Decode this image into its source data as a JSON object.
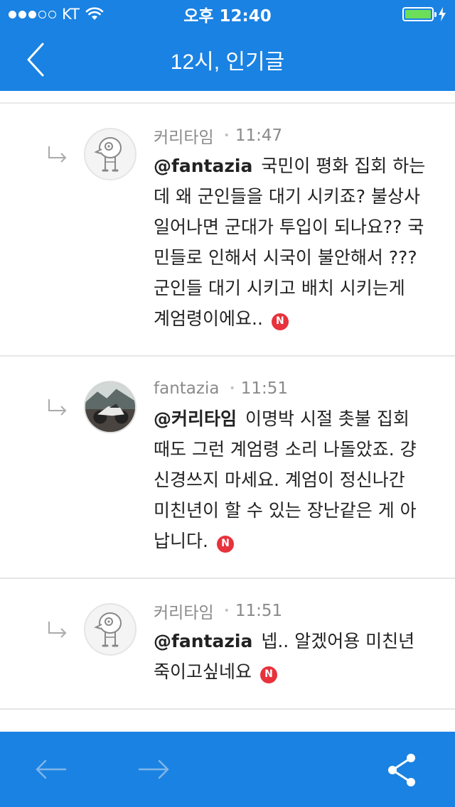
{
  "status_bar": {
    "carrier": "KT",
    "time": "오후 12:40"
  },
  "nav": {
    "title": "12시, 인기글",
    "back_icon": "chevron-left-icon"
  },
  "comments": [
    {
      "author": "커리타임",
      "time": "11:47",
      "mention": "@fantazia",
      "text": "국민이 평화 집회 하는데 왜 군인들을 대기 시키죠? 불상사 일어나면 군대가 투입이 되나요?? 국민들로 인해서 시국이 불안해서 ???군인들 대기 시키고 배치 시키는게 계엄령이에요..",
      "badge": "N",
      "avatar": "character-avatar"
    },
    {
      "author": "fantazia",
      "time": "11:51",
      "mention": "@커리타임",
      "text": "이명박 시절 촛불 집회 때도 그런 계엄령 소리 나돌았죠. 걍 신경쓰지 마세요. 계엄이 정신나간 미친년이 할 수 있는 장난같은 게 아납니다.",
      "badge": "N",
      "avatar": "motorcycle-photo-avatar"
    },
    {
      "author": "커리타임",
      "time": "11:51",
      "mention": "@fantazia",
      "text": "넵.. 알겠어용 미친년 죽이고싶네요",
      "badge": "N",
      "avatar": "character-avatar"
    }
  ],
  "toolbar": {
    "back_icon": "arrow-left-icon",
    "forward_icon": "arrow-right-icon",
    "share_icon": "share-icon"
  },
  "colors": {
    "brand_blue": "#1a82e2",
    "badge_red": "#e8323c",
    "battery_green": "#6dde5a"
  }
}
